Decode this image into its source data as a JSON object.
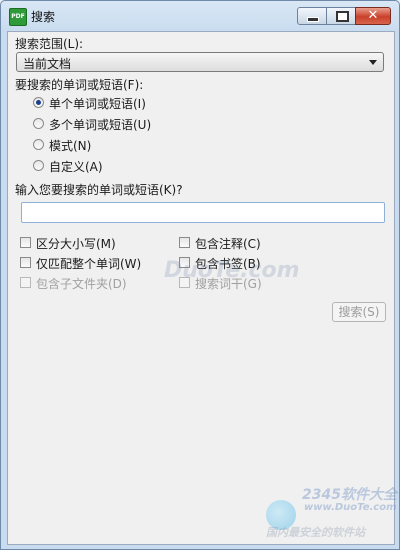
{
  "window": {
    "title": "搜索",
    "app_icon_text": "PDF",
    "close_glyph": "✕"
  },
  "scope": {
    "label": "搜索范围(L):",
    "selected": "当前文档"
  },
  "mode": {
    "label": "要搜索的单词或短语(F):",
    "options": [
      {
        "label": "单个单词或短语(I)",
        "selected": true
      },
      {
        "label": "多个单词或短语(U)",
        "selected": false
      },
      {
        "label": "模式(N)",
        "selected": false
      },
      {
        "label": "自定义(A)",
        "selected": false
      }
    ]
  },
  "query": {
    "label": "输入您要搜索的单词或短语(K)?",
    "value": "",
    "placeholder": ""
  },
  "options": {
    "match_case": {
      "label": "区分大小写(M)",
      "checked": false
    },
    "include_comments": {
      "label": "包含注释(C)",
      "checked": false
    },
    "whole_words": {
      "label": "仅匹配整个单词(W)",
      "checked": false
    },
    "include_bookmarks": {
      "label": "包含书签(B)",
      "checked": false
    },
    "include_subfolders": {
      "label": "包含子文件夹(D)",
      "checked": false,
      "disabled": true
    },
    "search_index": {
      "label": "搜索词干(G)",
      "checked": false,
      "disabled": true
    }
  },
  "search_button": {
    "label": "搜索(S)",
    "disabled": true
  },
  "watermark": {
    "center": "DuoTe.com",
    "brand": "2345软件大全",
    "url": "www.DuoTe.com",
    "tagline": "国内最安全的软件站"
  }
}
